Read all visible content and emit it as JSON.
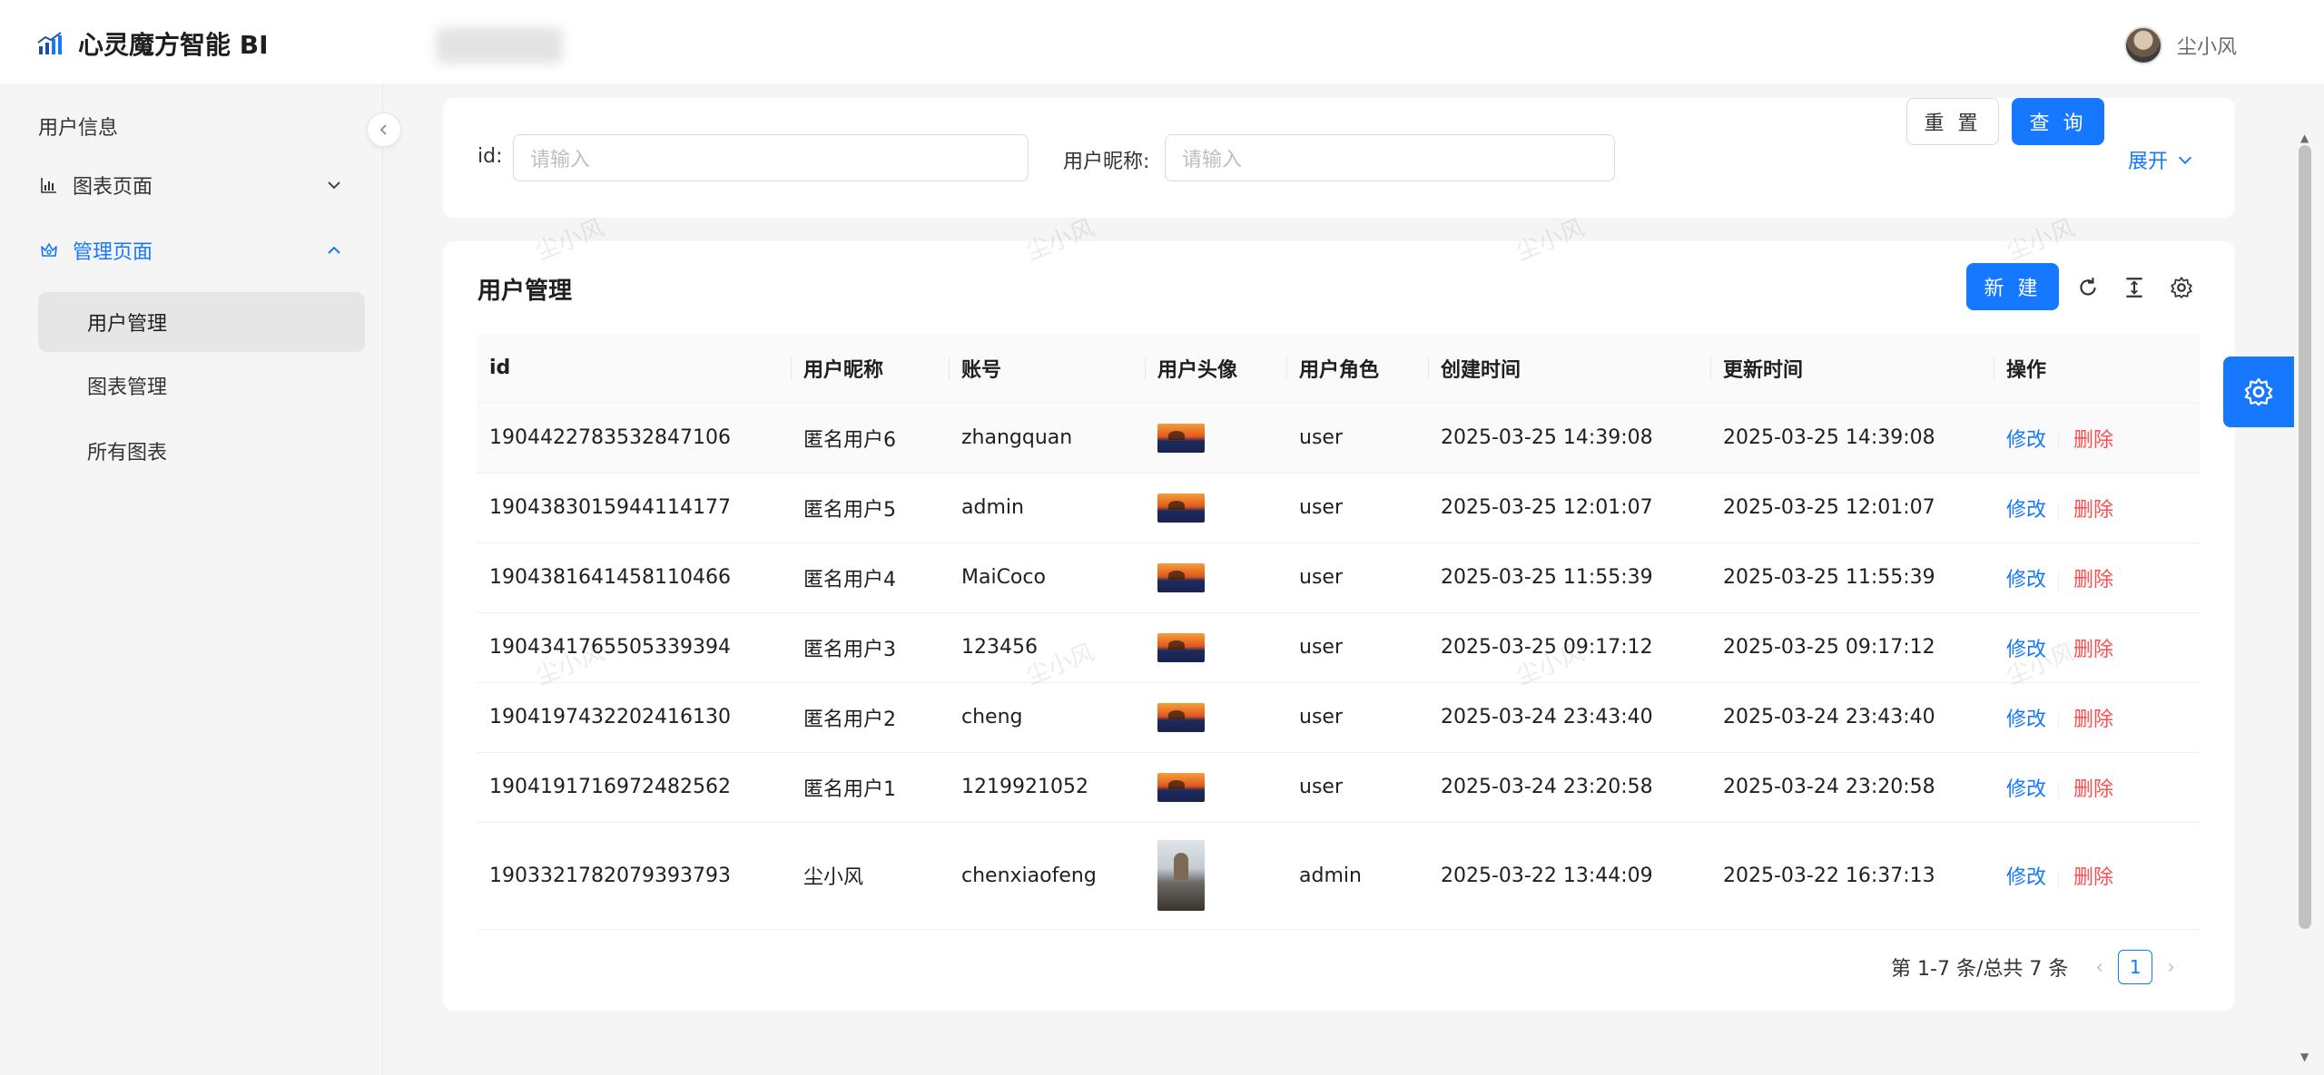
{
  "app": {
    "title": "心灵魔方智能 BI",
    "user_name": "尘小风"
  },
  "sidebar": {
    "items": [
      {
        "label": "用户信息"
      },
      {
        "label": "图表页面"
      },
      {
        "label": "管理页面"
      }
    ],
    "sub_items": [
      {
        "label": "用户管理"
      },
      {
        "label": "图表管理"
      },
      {
        "label": "所有图表"
      }
    ]
  },
  "search": {
    "id_label": "id:",
    "id_placeholder": "请输入",
    "nickname_label": "用户昵称:",
    "nickname_placeholder": "请输入",
    "reset_label": "重 置",
    "query_label": "查 询",
    "expand_label": "展开"
  },
  "table_card": {
    "title": "用户管理",
    "new_label": "新 建",
    "columns": [
      "id",
      "用户昵称",
      "账号",
      "用户头像",
      "用户角色",
      "创建时间",
      "更新时间",
      "操作"
    ],
    "rows": [
      {
        "id": "1904422783532847106",
        "nickname": "匿名用户6",
        "account": "zhangquan",
        "role": "user",
        "created": "2025-03-25 14:39:08",
        "updated": "2025-03-25 14:39:08",
        "edit": "修改",
        "delete": "删除"
      },
      {
        "id": "1904383015944114177",
        "nickname": "匿名用户5",
        "account": "admin",
        "role": "user",
        "created": "2025-03-25 12:01:07",
        "updated": "2025-03-25 12:01:07",
        "edit": "修改",
        "delete": "删除"
      },
      {
        "id": "1904381641458110466",
        "nickname": "匿名用户4",
        "account": "MaiCoco",
        "role": "user",
        "created": "2025-03-25 11:55:39",
        "updated": "2025-03-25 11:55:39",
        "edit": "修改",
        "delete": "删除"
      },
      {
        "id": "1904341765505339394",
        "nickname": "匿名用户3",
        "account": "123456",
        "role": "user",
        "created": "2025-03-25 09:17:12",
        "updated": "2025-03-25 09:17:12",
        "edit": "修改",
        "delete": "删除"
      },
      {
        "id": "1904197432202416130",
        "nickname": "匿名用户2",
        "account": "cheng",
        "role": "user",
        "created": "2025-03-24 23:43:40",
        "updated": "2025-03-24 23:43:40",
        "edit": "修改",
        "delete": "删除"
      },
      {
        "id": "1904191716972482562",
        "nickname": "匿名用户1",
        "account": "1219921052",
        "role": "user",
        "created": "2025-03-24 23:20:58",
        "updated": "2025-03-24 23:20:58",
        "edit": "修改",
        "delete": "删除"
      },
      {
        "id": "1903321782079393793",
        "nickname": "尘小风",
        "account": "chenxiaofeng",
        "role": "admin",
        "created": "2025-03-22 13:44:09",
        "updated": "2025-03-22 16:37:13",
        "edit": "修改",
        "delete": "删除"
      }
    ]
  },
  "pagination": {
    "summary": "第 1-7 条/总共 7 条",
    "current": "1"
  },
  "watermark": "尘小风",
  "colors": {
    "primary": "#1677ff",
    "danger": "#ff4d4f"
  }
}
